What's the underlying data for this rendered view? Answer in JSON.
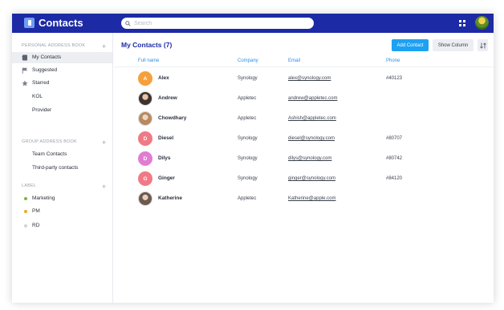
{
  "app": {
    "title": "Contacts"
  },
  "search": {
    "placeholder": "Search"
  },
  "sidebar": {
    "personal": {
      "heading": "PERSONAL ADDRESS BOOK",
      "items": [
        {
          "label": "My Contacts",
          "icon": "contacts-book-icon",
          "active": true
        },
        {
          "label": "Suggested",
          "icon": "flag-icon"
        },
        {
          "label": "Starred",
          "icon": "star-icon"
        },
        {
          "label": "KOL"
        },
        {
          "label": "Provider"
        }
      ]
    },
    "group": {
      "heading": "GROUP ADDRESS BOOK",
      "items": [
        {
          "label": "Team Contacts"
        },
        {
          "label": "Third-party contacts"
        }
      ]
    },
    "label": {
      "heading": "LABEL",
      "items": [
        {
          "label": "Marketing",
          "color": "#7cb342"
        },
        {
          "label": "PM",
          "color": "#f5a623"
        },
        {
          "label": "RD",
          "color": "#cfd3da"
        }
      ]
    }
  },
  "main": {
    "title": "My Contacts (7)",
    "add_contact_label": "Add Contact",
    "show_column_label": "Show Column",
    "columns": {
      "name": "Full name",
      "company": "Company",
      "email": "Email",
      "phone": "Phone"
    }
  },
  "contacts": [
    {
      "initial": "A",
      "name": "Alex",
      "company": "Synology",
      "email": "alex@synology.com",
      "phone": "#40123",
      "avatar_color": "#f5a03c"
    },
    {
      "initial": "",
      "name": "Andrew",
      "company": "Appletec",
      "email": "andrew@appletec.com",
      "phone": "",
      "avatar_color": "#5a4a45"
    },
    {
      "initial": "",
      "name": "Chowdhary",
      "company": "Appletec",
      "email": "Ashish@appletec.com",
      "phone": "",
      "avatar_color": "#c8a27a"
    },
    {
      "initial": "D",
      "name": "Diesel",
      "company": "Synology",
      "email": "diesel@synology.com",
      "phone": "#80707",
      "avatar_color": "#ef7a86"
    },
    {
      "initial": "D",
      "name": "Dilys",
      "company": "Synology",
      "email": "dilys@synology.com",
      "phone": "#80742",
      "avatar_color": "#e07dd2"
    },
    {
      "initial": "G",
      "name": "Ginger",
      "company": "Synology",
      "email": "ginger@synology.com",
      "phone": "#84120",
      "avatar_color": "#ef7a86"
    },
    {
      "initial": "",
      "name": "Katherine",
      "company": "Appletec",
      "email": "Katherine@apple.com",
      "phone": "",
      "avatar_color": "#7b6a60"
    }
  ]
}
